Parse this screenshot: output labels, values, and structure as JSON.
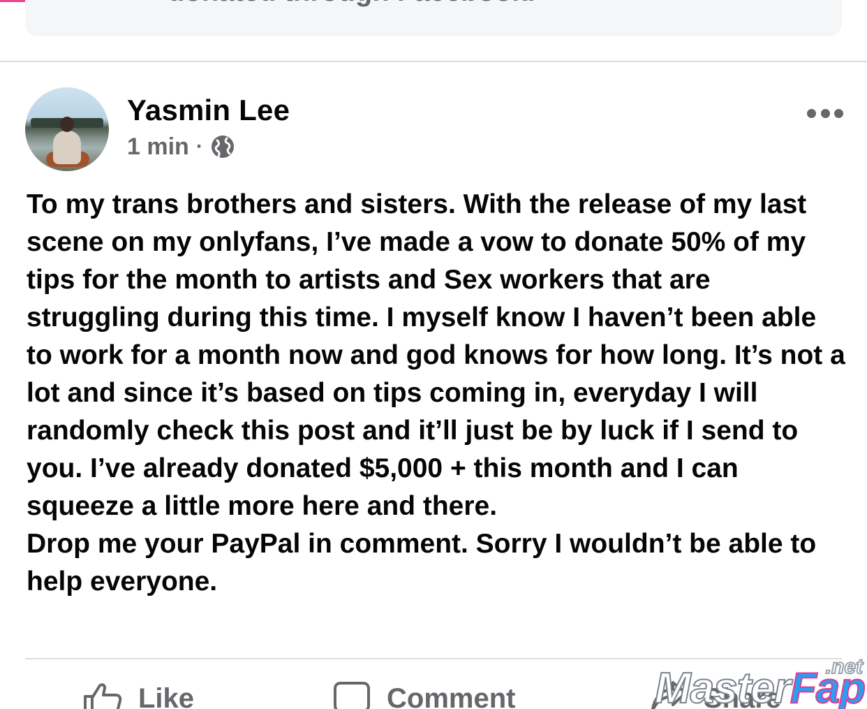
{
  "previous_post": {
    "text": "donated through Facebook."
  },
  "post": {
    "author": "Yasmin Lee",
    "timestamp": "1 min",
    "separator": "·",
    "privacy_icon": "globe-icon",
    "more_icon": "more-options-icon",
    "body": [
      "To my trans brothers and sisters. With the release of my last scene on my onlyfans, I’ve made a vow to donate 50% of my tips for the month to artists and Sex workers that are struggling during this time. I myself know I haven’t been able to work for a month now and god knows for how long. It’s not a lot and since it’s based on tips coming in, everyday I will randomly check this post and it’ll just be by luck if I send to you. I’ve already donated $5,000 + this month and I can squeeze a little more here and there.",
      "Drop me your PayPal in comment. Sorry I wouldn’t be able to help everyone."
    ]
  },
  "actions": {
    "like": {
      "label": "Like",
      "icon": "thumbs-up-icon"
    },
    "comment": {
      "label": "Comment",
      "icon": "comment-bubble-icon"
    },
    "share": {
      "label": "Share",
      "icon": "share-arrow-icon"
    }
  },
  "watermark": {
    "word1": "Master",
    "word2": "Fap",
    "suffix": ".net"
  },
  "colors": {
    "text_primary": "#050505",
    "text_secondary": "#65676b",
    "divider": "#dadde1",
    "accent_pink": "#e8458b"
  }
}
